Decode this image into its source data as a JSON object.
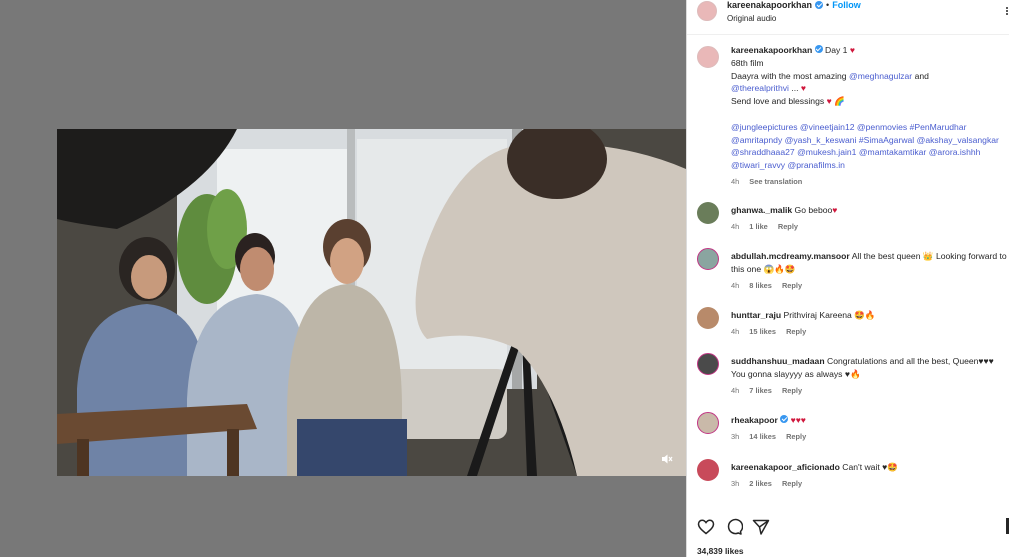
{
  "header": {
    "username": "kareenakapoorkhan",
    "dot": "•",
    "follow_label": "Follow",
    "audio": "Original audio"
  },
  "caption": {
    "username": "kareenakapoorkhan",
    "line1": "Day 1",
    "line2": "68th film",
    "line3_pre": "Daayra with the most amazing",
    "mention1": "@meghnagulzar",
    "line3_post": "and",
    "mention2": "@therealprithvi",
    "line4_post": "...",
    "line5": "Send love and blessings",
    "tags": [
      "@jungleepictures",
      "@vineetjain12",
      "@penmovies",
      "#PenMarudhar",
      "@amritapndy",
      "@yash_k_keswani",
      "#SimaAgarwal",
      "@akshay_valsangkar",
      "@shraddhaaa27",
      "@mukesh.jain1",
      "@mamtakamtikar",
      "@arora.ishhh",
      "@tiwari_ravvy",
      "@pranafilms.in"
    ],
    "time": "4h",
    "see_translation": "See translation"
  },
  "comments": [
    {
      "username": "ghanwa._malik",
      "text": "Go beboo",
      "emoji": "♥",
      "time": "4h",
      "likes": "1 like",
      "reply": "Reply",
      "avatar_color": "#6a7d5a"
    },
    {
      "username": "abdullah.mcdreamy.mansoor",
      "text": "All the best queen 👑 Looking forward to this one 😱🔥🤩",
      "emoji": "",
      "time": "4h",
      "likes": "8 likes",
      "reply": "Reply",
      "avatar_color": "#8aa5a0"
    },
    {
      "username": "hunttar_raju",
      "text": "Prithviraj Kareena 🤩🔥",
      "emoji": "",
      "time": "4h",
      "likes": "15 likes",
      "reply": "Reply",
      "avatar_color": "#b88a6a"
    },
    {
      "username": "suddhanshuu_madaan",
      "text": "Congratulations and all the best, Queen♥♥♥ You gonna slayyyy as always ♥🔥",
      "emoji": "",
      "time": "4h",
      "likes": "7 likes",
      "reply": "Reply",
      "avatar_color": "#4a4a4a"
    },
    {
      "username": "rheakapoor",
      "text": "♥♥♥",
      "emoji": "",
      "time": "3h",
      "likes": "14 likes",
      "reply": "Reply",
      "avatar_color": "#c9b9a9"
    },
    {
      "username": "kareenakapoor_aficionado",
      "text": "Can't wait ♥🤩",
      "emoji": "",
      "time": "3h",
      "likes": "2 likes",
      "reply": "Reply",
      "avatar_color": "#c84a5a"
    }
  ],
  "footer": {
    "likes": "34,839 likes"
  },
  "icons": {
    "like": "heart-outline-icon",
    "comment": "comment-bubble-icon",
    "share": "paper-plane-icon",
    "save": "bookmark-icon",
    "mute": "speaker-muted-icon",
    "more": "more-options-icon",
    "verified": "verified-badge-icon"
  },
  "colors": {
    "accent": "#0095f6",
    "mention": "#4a5dcf",
    "heart": "#d0173c",
    "page_bg": "#787878"
  }
}
